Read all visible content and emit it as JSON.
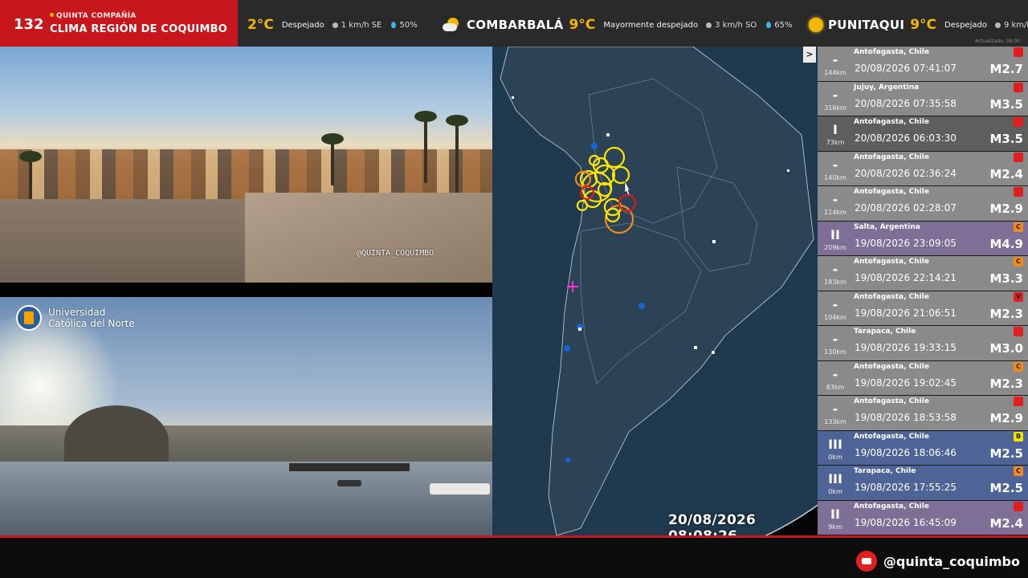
{
  "channel": {
    "number": "132",
    "subtitle": "QUINTA COMPAÑÍA",
    "title": "CLIMA REGIÓN DE COQUIMBO"
  },
  "weather": [
    {
      "city": "",
      "temp": "2°C",
      "desc": "Despejado",
      "wind": "1 km/h SE",
      "humidity": "50%",
      "icon": "none"
    },
    {
      "city": "COMBARBALÁ",
      "temp": "9°C",
      "desc": "Mayormente despejado",
      "wind": "3 km/h SO",
      "humidity": "65%",
      "icon": "sun-cloud-icon"
    },
    {
      "city": "PUNITAQUI",
      "temp": "9°C",
      "desc": "Despejado",
      "wind": "9 km/h",
      "humidity": "",
      "icon": "sun-icon"
    }
  ],
  "updated": "Actualizado: 08:00",
  "cam1": {
    "watermark": "@QUINTA_COQUIMBO"
  },
  "cam2": {
    "logo_line1": "Universidad",
    "logo_line2": "Católica del Norte"
  },
  "map": {
    "toggle": ">",
    "timestamp": "20/08/2026 08:08:26"
  },
  "quakes": [
    {
      "intensity": "-",
      "dist": "144km",
      "place": "Antofagasta, Chile",
      "datetime": "20/08/2026 07:41:07",
      "mag": "M2.7",
      "cls": "",
      "cls_color": "#e02020",
      "bg": "#8a8a8a"
    },
    {
      "intensity": "-",
      "dist": "316km",
      "place": "Jujuy, Argentina",
      "datetime": "20/08/2026 07:35:58",
      "mag": "M3.5",
      "cls": "",
      "cls_color": "#e02020",
      "bg": "#8a8a8a"
    },
    {
      "intensity": "I",
      "dist": "73km",
      "place": "Antofagasta, Chile",
      "datetime": "20/08/2026 06:03:30",
      "mag": "M3.5",
      "cls": "",
      "cls_color": "#e02020",
      "bg": "#5e5e5e"
    },
    {
      "intensity": "-",
      "dist": "140km",
      "place": "Antofagasta, Chile",
      "datetime": "20/08/2026 02:36:24",
      "mag": "M2.4",
      "cls": "",
      "cls_color": "#e02020",
      "bg": "#8a8a8a"
    },
    {
      "intensity": "-",
      "dist": "114km",
      "place": "Antofagasta, Chile",
      "datetime": "20/08/2026 02:28:07",
      "mag": "M2.9",
      "cls": "",
      "cls_color": "#e02020",
      "bg": "#8a8a8a"
    },
    {
      "intensity": "II",
      "dist": "209km",
      "place": "Salta, Argentina",
      "datetime": "19/08/2026 23:09:05",
      "mag": "M4.9",
      "cls": "C",
      "cls_color": "#f08a1e",
      "bg": "#7d6f95"
    },
    {
      "intensity": "-",
      "dist": "183km",
      "place": "Antofagasta, Chile",
      "datetime": "19/08/2026 22:14:21",
      "mag": "M3.3",
      "cls": "C",
      "cls_color": "#f08a1e",
      "bg": "#8a8a8a"
    },
    {
      "intensity": "-",
      "dist": "104km",
      "place": "Antofagasta, Chile",
      "datetime": "19/08/2026 21:06:51",
      "mag": "M2.3",
      "cls": "V",
      "cls_color": "#e02020",
      "bg": "#8a8a8a"
    },
    {
      "intensity": "-",
      "dist": "130km",
      "place": "Tarapaca, Chile",
      "datetime": "19/08/2026 19:33:15",
      "mag": "M3.0",
      "cls": "",
      "cls_color": "#e02020",
      "bg": "#8a8a8a"
    },
    {
      "intensity": "-",
      "dist": "83km",
      "place": "Antofagasta, Chile",
      "datetime": "19/08/2026 19:02:45",
      "mag": "M2.3",
      "cls": "C",
      "cls_color": "#f08a1e",
      "bg": "#8a8a8a"
    },
    {
      "intensity": "-",
      "dist": "133km",
      "place": "Antofagasta, Chile",
      "datetime": "19/08/2026 18:53:58",
      "mag": "M2.9",
      "cls": "",
      "cls_color": "#e02020",
      "bg": "#8a8a8a"
    },
    {
      "intensity": "III",
      "dist": "0km",
      "place": "Antofagasta, Chile",
      "datetime": "19/08/2026 18:06:46",
      "mag": "M2.5",
      "cls": "B",
      "cls_color": "#f2e300",
      "bg": "#4f6496"
    },
    {
      "intensity": "III",
      "dist": "0km",
      "place": "Tarapaca, Chile",
      "datetime": "19/08/2026 17:55:25",
      "mag": "M2.5",
      "cls": "C",
      "cls_color": "#f08a1e",
      "bg": "#4f6496"
    },
    {
      "intensity": "II",
      "dist": "9km",
      "place": "Antofagasta, Chile",
      "datetime": "19/08/2026 16:45:09",
      "mag": "M2.4",
      "cls": "",
      "cls_color": "#e02020",
      "bg": "#7d6f95"
    }
  ],
  "social": {
    "handle": "@quinta_coquimbo"
  }
}
